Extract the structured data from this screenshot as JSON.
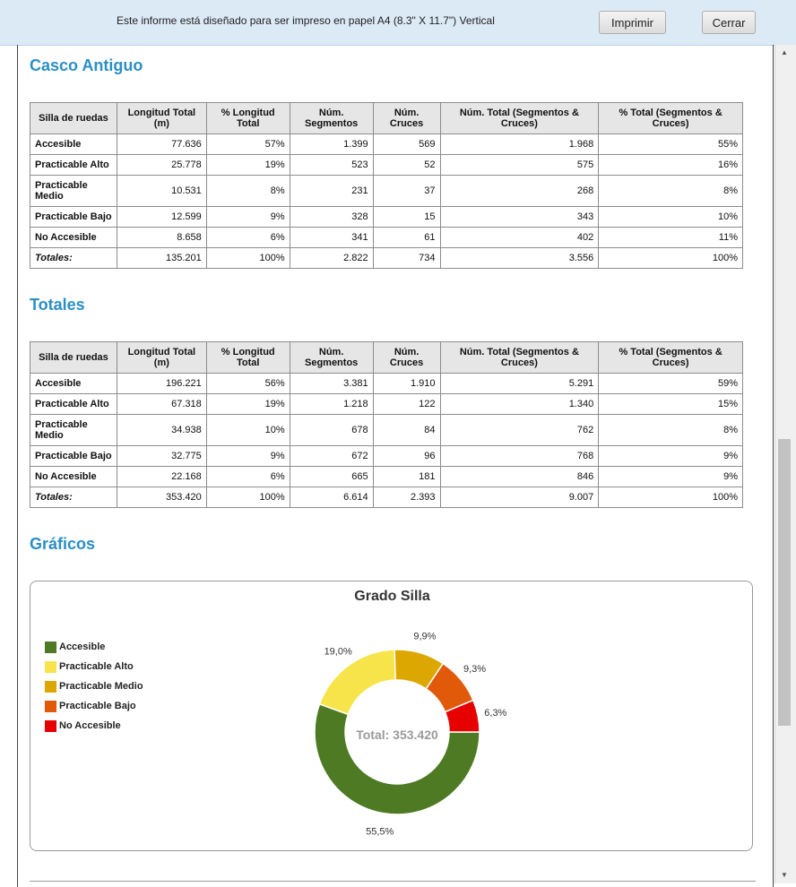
{
  "topbar": {
    "message": "Este informe está diseñado para ser impreso en papel A4 (8.3\" X 11.7\") Vertical",
    "print_label": "Imprimir",
    "close_label": "Cerrar"
  },
  "headers": [
    "Silla de ruedas",
    "Longitud Total (m)",
    "% Longitud Total",
    "Núm. Segmentos",
    "Núm. Cruces",
    "Núm. Total (Segmentos & Cruces)",
    "% Total (Segmentos & Cruces)"
  ],
  "sections": [
    {
      "title": "Casco Antiguo",
      "rows": [
        [
          "Accesible",
          "77.636",
          "57%",
          "1.399",
          "569",
          "1.968",
          "55%"
        ],
        [
          "Practicable Alto",
          "25.778",
          "19%",
          "523",
          "52",
          "575",
          "16%"
        ],
        [
          "Practicable Medio",
          "10.531",
          "8%",
          "231",
          "37",
          "268",
          "8%"
        ],
        [
          "Practicable Bajo",
          "12.599",
          "9%",
          "328",
          "15",
          "343",
          "10%"
        ],
        [
          "No Accesible",
          "8.658",
          "6%",
          "341",
          "61",
          "402",
          "11%"
        ],
        [
          "Totales:",
          "135.201",
          "100%",
          "2.822",
          "734",
          "3.556",
          "100%"
        ]
      ]
    },
    {
      "title": "Totales",
      "rows": [
        [
          "Accesible",
          "196.221",
          "56%",
          "3.381",
          "1.910",
          "5.291",
          "59%"
        ],
        [
          "Practicable Alto",
          "67.318",
          "19%",
          "1.218",
          "122",
          "1.340",
          "15%"
        ],
        [
          "Practicable Medio",
          "34.938",
          "10%",
          "678",
          "84",
          "762",
          "8%"
        ],
        [
          "Practicable Bajo",
          "32.775",
          "9%",
          "672",
          "96",
          "768",
          "9%"
        ],
        [
          "No Accesible",
          "22.168",
          "6%",
          "665",
          "181",
          "846",
          "9%"
        ],
        [
          "Totales:",
          "353.420",
          "100%",
          "6.614",
          "2.393",
          "9.007",
          "100%"
        ]
      ]
    }
  ],
  "charts_heading": "Gráficos",
  "chart_data": {
    "type": "pie",
    "title": "Grado Silla",
    "center_label": "Total: 353.420",
    "legend_position": "left",
    "categories": [
      "Accesible",
      "Practicable Alto",
      "Practicable Medio",
      "Practicable Bajo",
      "No Accesible"
    ],
    "values": [
      55.5,
      19.0,
      9.9,
      9.3,
      6.3
    ],
    "labels": [
      "55,5%",
      "19,0%",
      "9,9%",
      "9,3%",
      "6,3%"
    ],
    "colors": [
      "#4e7a23",
      "#f7e44a",
      "#dba700",
      "#e05a0a",
      "#e60000"
    ]
  }
}
